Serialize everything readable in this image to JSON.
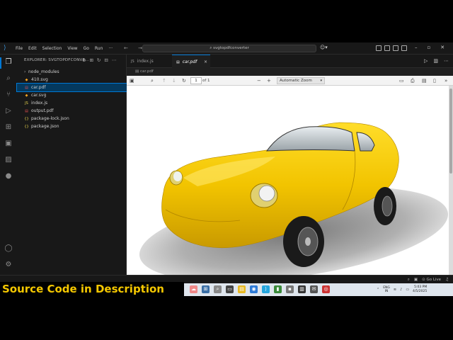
{
  "titlebar": {
    "menu": [
      "File",
      "Edit",
      "Selection",
      "View",
      "Go",
      "Run",
      "···"
    ],
    "nav_arrows": "← →",
    "search_text": "svgtopdfconverter"
  },
  "sidebar": {
    "header": "EXPLORER: SVGTOPDFCONVE...",
    "items": [
      {
        "name": "node_modules",
        "icon": "folder-icon",
        "glyph": "›"
      },
      {
        "name": "410.svg",
        "icon": "svg-file-icon",
        "glyph": "◆"
      },
      {
        "name": "car.pdf",
        "icon": "pdf-file-icon",
        "glyph": "▤"
      },
      {
        "name": "car.svg",
        "icon": "svg-file-icon",
        "glyph": "◆"
      },
      {
        "name": "index.js",
        "icon": "js-file-icon",
        "glyph": "JS"
      },
      {
        "name": "output.pdf",
        "icon": "pdf-file-icon",
        "glyph": "▤"
      },
      {
        "name": "package-lock.json",
        "icon": "json-file-icon",
        "glyph": "{}"
      },
      {
        "name": "package.json",
        "icon": "json-file-icon",
        "glyph": "{}"
      }
    ],
    "active_index": 2
  },
  "tabs": [
    {
      "label": "index.js",
      "icon": "JS"
    },
    {
      "label": "car.pdf",
      "icon": "▤",
      "close": "×"
    }
  ],
  "breadcrumb": "▤ car.pdf",
  "pdf_toolbar": {
    "page_current": "1",
    "page_total": "of 1",
    "zoom": "Automatic Zoom",
    "minus": "−",
    "plus": "+"
  },
  "banner": {
    "text": "Source Code in  Description"
  },
  "tray": {
    "lang_top": "ENG",
    "lang_bottom": "IN",
    "time": "5:03 PM",
    "date": "4/5/2025"
  },
  "colors": {
    "accent": "#0078d4",
    "banner": "#f5c800",
    "car_body": "#f2c400"
  }
}
